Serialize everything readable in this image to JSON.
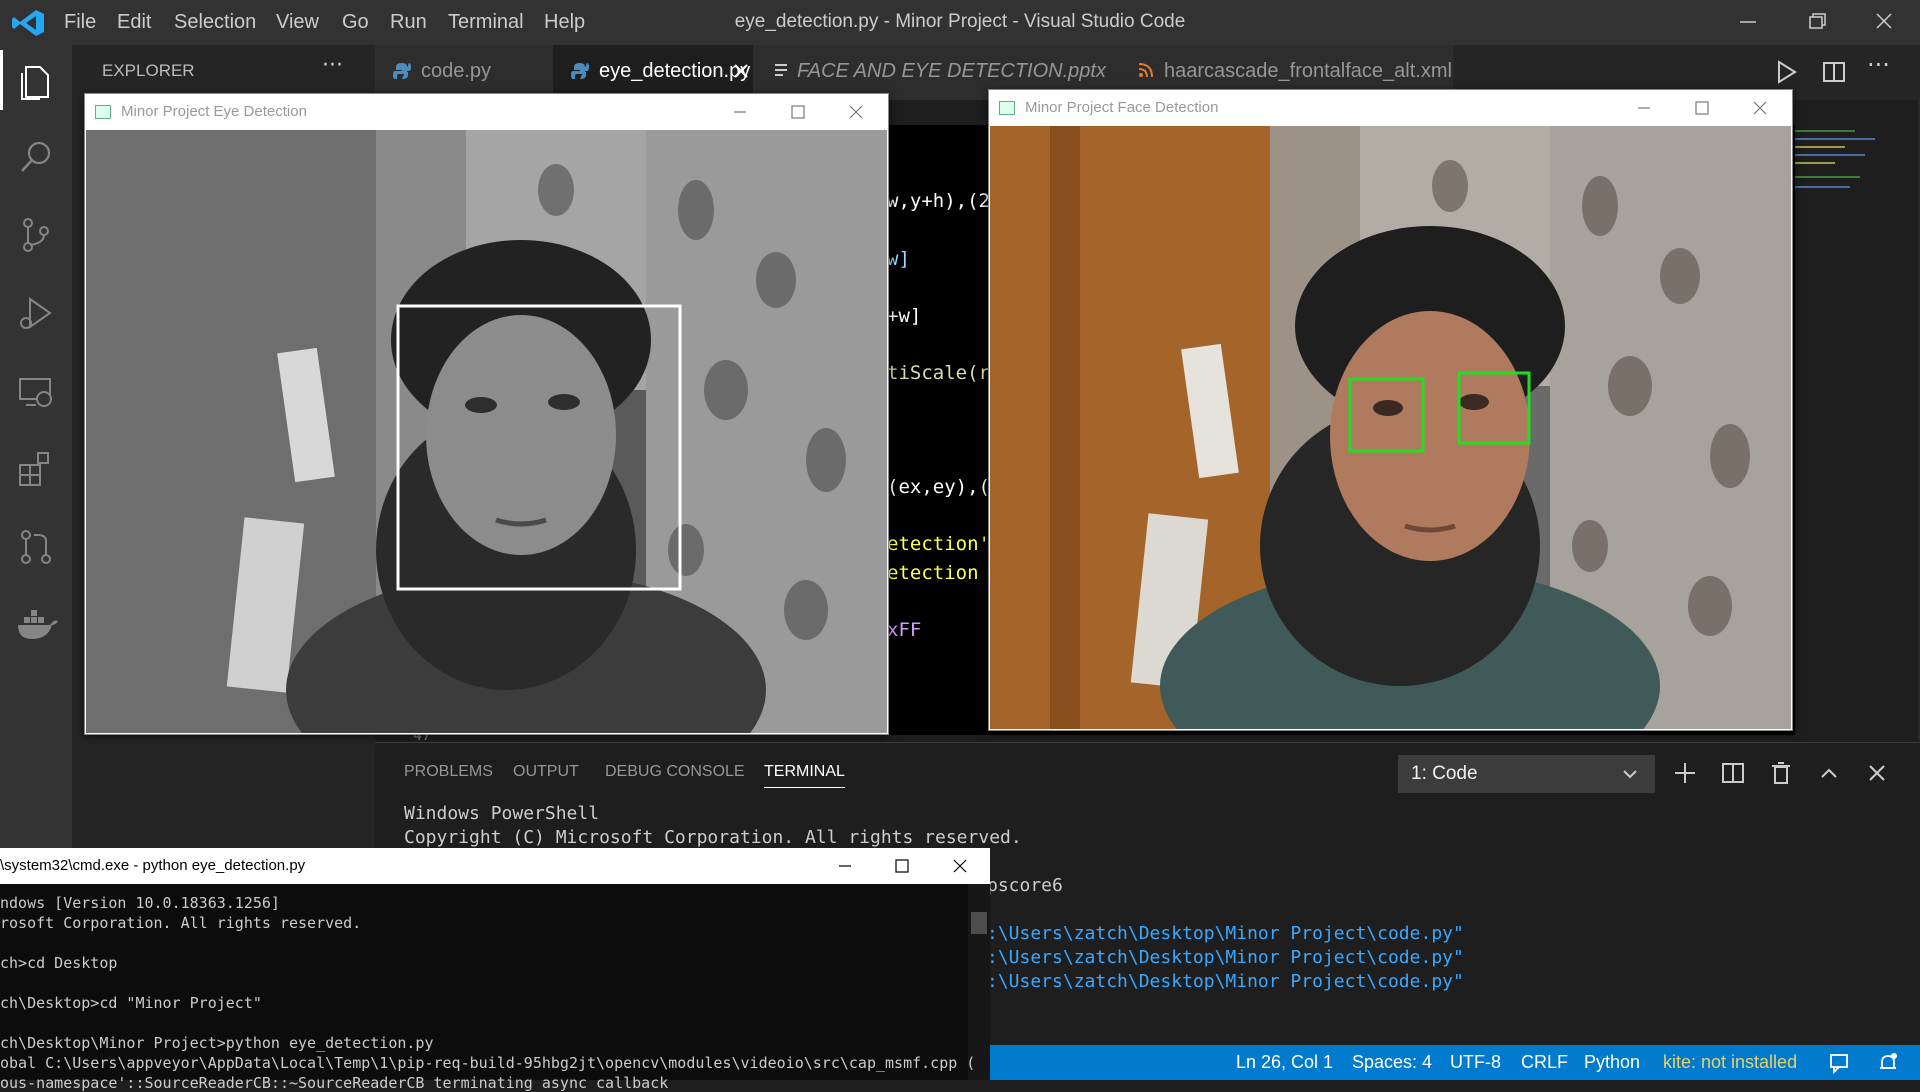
{
  "titlebar": {
    "menu": [
      "File",
      "Edit",
      "Selection",
      "View",
      "Go",
      "Run",
      "Terminal",
      "Help"
    ],
    "window_title": "eye_detection.py - Minor Project - Visual Studio Code"
  },
  "sidebar": {
    "title": "EXPLORER",
    "more": "···"
  },
  "tabs": [
    {
      "label": "code.py",
      "active": false
    },
    {
      "label": "eye_detection.py",
      "active": true
    },
    {
      "label": "FACE AND EYE DETECTION.pptx",
      "active": false
    },
    {
      "label": "haarcascade_frontalface_alt.xml",
      "active": false
    }
  ],
  "editor": {
    "fragments": [
      "w,y+h),(2",
      "w]",
      "+w]",
      "tiScale(r",
      "(ex,ey),(",
      "etection',",
      "etection",
      "xFF",
      "47"
    ]
  },
  "eye_window": {
    "title": "Minor Project Eye Detection"
  },
  "face_window": {
    "title": "Minor Project Face Detection"
  },
  "panel": {
    "tabs": [
      "PROBLEMS",
      "OUTPUT",
      "DEBUG CONSOLE",
      "TERMINAL"
    ],
    "terminal_select": "1: Code",
    "lines": [
      "Windows PowerShell",
      "Copyright (C) Microsoft Corporation. All rights reserved.",
      "pscore6",
      ":\\Users\\zatch\\Desktop\\Minor Project\\code.py\"",
      ":\\Users\\zatch\\Desktop\\Minor Project\\code.py\"",
      ":\\Users\\zatch\\Desktop\\Minor Project\\code.py\""
    ]
  },
  "cmd": {
    "title": "\\system32\\cmd.exe - python  eye_detection.py",
    "lines": [
      "ndows [Version 10.0.18363.1256]",
      "rosoft Corporation. All rights reserved.",
      "",
      "ch>cd Desktop",
      "",
      "ch\\Desktop>cd \"Minor Project\"",
      "",
      "ch\\Desktop\\Minor Project>python eye_detection.py",
      "obal C:\\Users\\appveyor\\AppData\\Local\\Temp\\1\\pip-req-build-95hbg2jt\\opencv\\modules\\videoio\\src\\cap_msmf.cpp (",
      "ous-namespace'::SourceReaderCB::~SourceReaderCB terminating async callback"
    ]
  },
  "statusbar": {
    "position": "Ln 26, Col 1",
    "spaces": "Spaces: 4",
    "encoding": "UTF-8",
    "eol": "CRLF",
    "language": "Python",
    "kite": "kite: not installed"
  },
  "colors": {
    "accent": "#007acc",
    "detection_box_eye": "#22dd22",
    "detection_box_face": "#ffffff"
  }
}
